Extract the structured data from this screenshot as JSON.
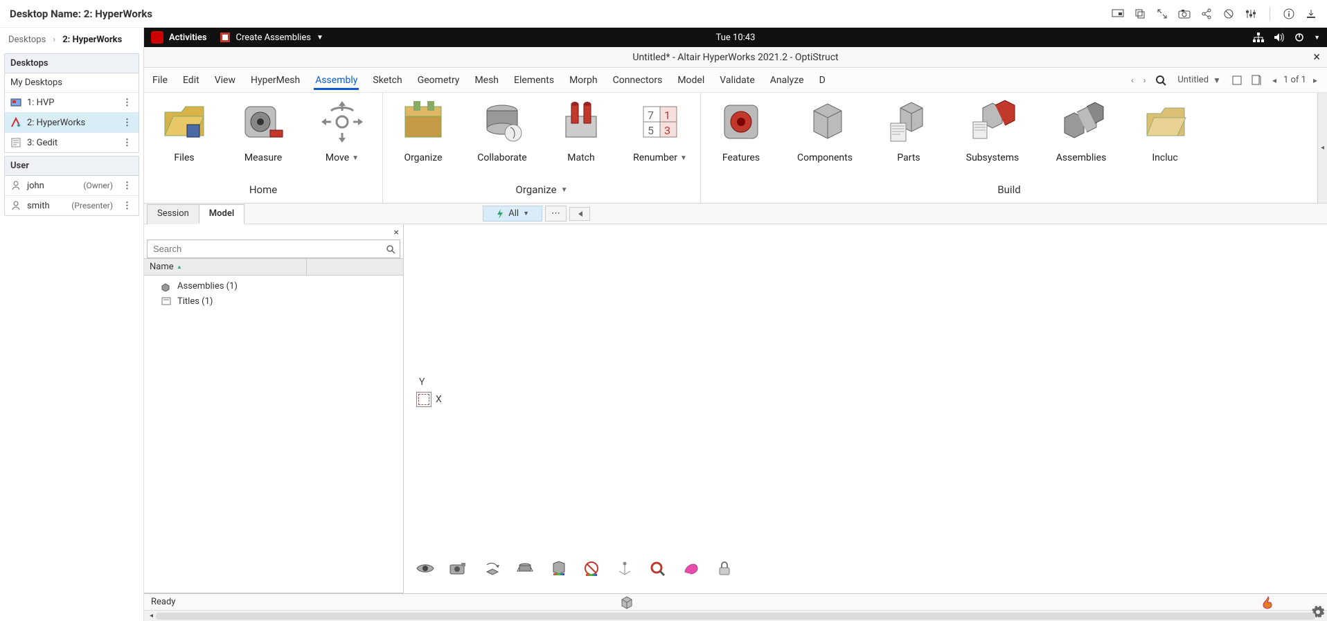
{
  "header": {
    "title_prefix": "Desktop Name: ",
    "title_value": "2: HyperWorks"
  },
  "breadcrumb": {
    "root": "Desktops",
    "current": "2: HyperWorks"
  },
  "sidebar": {
    "desktops_head": "Desktops",
    "my_desktops": "My Desktops",
    "items": [
      {
        "label": "1: HVP"
      },
      {
        "label": "2: HyperWorks"
      },
      {
        "label": "3: Gedit"
      }
    ],
    "user_head": "User",
    "users": [
      {
        "name": "john",
        "role": "(Owner)"
      },
      {
        "name": "smith",
        "role": "(Presenter)"
      }
    ]
  },
  "gnome": {
    "activities": "Activities",
    "app_label": "Create Assemblies",
    "clock": "Tue 10:43"
  },
  "window": {
    "title": "Untitled* - Altair HyperWorks 2021.2 - OptiStruct"
  },
  "menus": {
    "items": [
      "File",
      "Edit",
      "View",
      "HyperMesh",
      "Assembly",
      "Sketch",
      "Geometry",
      "Mesh",
      "Elements",
      "Morph",
      "Connectors",
      "Model",
      "Validate",
      "Analyze",
      "D"
    ],
    "active_index": 4,
    "tab_selector": "Untitled",
    "pager": "1 of 1"
  },
  "ribbon": {
    "groups": [
      {
        "label": "Home",
        "items": [
          {
            "label": "Files",
            "icon": "files"
          },
          {
            "label": "Measure",
            "icon": "measure"
          },
          {
            "label": "Move",
            "icon": "move",
            "dropdown": true
          }
        ]
      },
      {
        "label": "Organize",
        "dropdown": true,
        "items": [
          {
            "label": "Organize",
            "icon": "organize"
          },
          {
            "label": "Collaborate",
            "icon": "collaborate"
          },
          {
            "label": "Match",
            "icon": "match"
          },
          {
            "label": "Renumber",
            "icon": "renumber",
            "dropdown": true
          }
        ]
      },
      {
        "label": "Build",
        "items": [
          {
            "label": "Features",
            "icon": "features"
          },
          {
            "label": "Components",
            "icon": "components"
          },
          {
            "label": "Parts",
            "icon": "parts"
          },
          {
            "label": "Subsystems",
            "icon": "subsystems"
          },
          {
            "label": "Assemblies",
            "icon": "assemblies"
          },
          {
            "label": "Incluc",
            "icon": "includes"
          }
        ]
      }
    ]
  },
  "subtabs": {
    "items": [
      "Session",
      "Model"
    ],
    "active_index": 1
  },
  "entity_selector": {
    "label": "All"
  },
  "browser": {
    "search_placeholder": "Search",
    "column": "Name",
    "nodes": [
      {
        "label": "Assemblies  (1)"
      },
      {
        "label": "Titles  (1)"
      }
    ]
  },
  "axis": {
    "y": "Y",
    "x": "X"
  },
  "status": {
    "text": "Ready"
  }
}
